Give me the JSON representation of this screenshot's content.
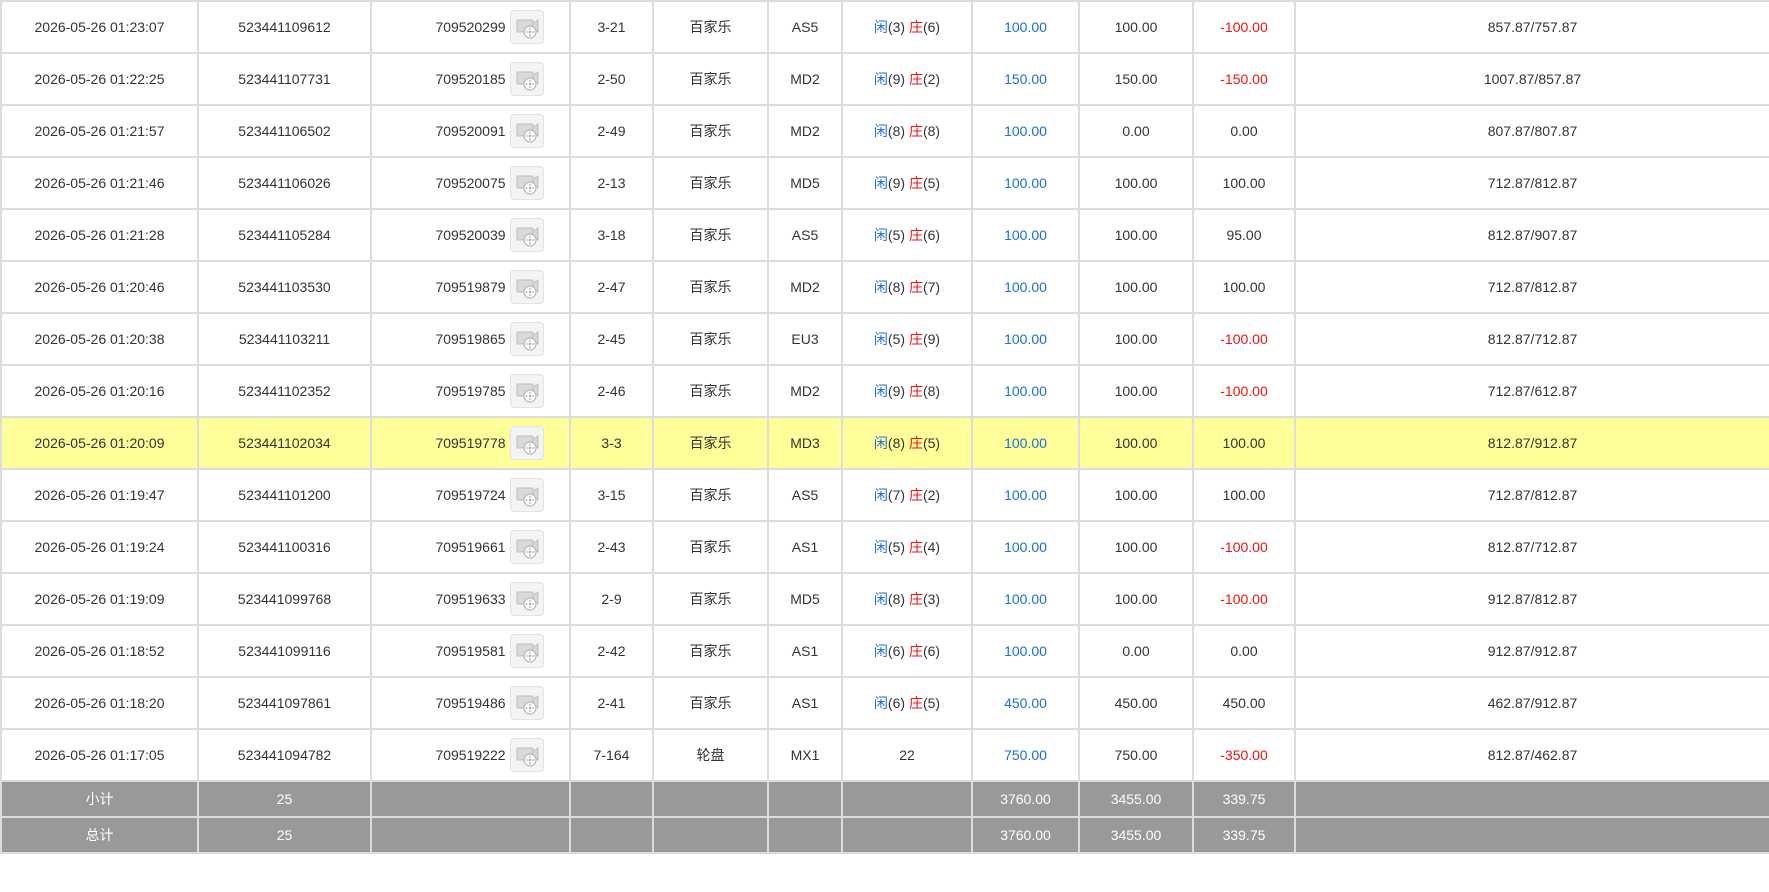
{
  "colors": {
    "positive": "#1a6fe0",
    "negative": "#ee1111",
    "highlight_row": "#ffff99",
    "summary_bg": "#999999"
  },
  "icons": {
    "replay": "film-reel-icon"
  },
  "rows": [
    {
      "time": "2026-05-26 01:23:07",
      "bet_no": "523441109612",
      "game_no": "709520299",
      "shoe": "3-21",
      "game": "百家乐",
      "table": "AS5",
      "player_label": "闲",
      "player_val": "(3)",
      "banker_label": "庄",
      "banker_val": "(6)",
      "result_text": "",
      "bet": "100.00",
      "valid": "100.00",
      "win": "-100.00",
      "win_neg": true,
      "balance": "857.87/757.87",
      "highlight": false
    },
    {
      "time": "2026-05-26 01:22:25",
      "bet_no": "523441107731",
      "game_no": "709520185",
      "shoe": "2-50",
      "game": "百家乐",
      "table": "MD2",
      "player_label": "闲",
      "player_val": "(9)",
      "banker_label": "庄",
      "banker_val": "(2)",
      "result_text": "",
      "bet": "150.00",
      "valid": "150.00",
      "win": "-150.00",
      "win_neg": true,
      "balance": "1007.87/857.87",
      "highlight": false
    },
    {
      "time": "2026-05-26 01:21:57",
      "bet_no": "523441106502",
      "game_no": "709520091",
      "shoe": "2-49",
      "game": "百家乐",
      "table": "MD2",
      "player_label": "闲",
      "player_val": "(8)",
      "banker_label": "庄",
      "banker_val": "(8)",
      "result_text": "",
      "bet": "100.00",
      "valid": "0.00",
      "win": "0.00",
      "win_neg": false,
      "balance": "807.87/807.87",
      "highlight": false
    },
    {
      "time": "2026-05-26 01:21:46",
      "bet_no": "523441106026",
      "game_no": "709520075",
      "shoe": "2-13",
      "game": "百家乐",
      "table": "MD5",
      "player_label": "闲",
      "player_val": "(9)",
      "banker_label": "庄",
      "banker_val": "(5)",
      "result_text": "",
      "bet": "100.00",
      "valid": "100.00",
      "win": "100.00",
      "win_neg": false,
      "balance": "712.87/812.87",
      "highlight": false
    },
    {
      "time": "2026-05-26 01:21:28",
      "bet_no": "523441105284",
      "game_no": "709520039",
      "shoe": "3-18",
      "game": "百家乐",
      "table": "AS5",
      "player_label": "闲",
      "player_val": "(5)",
      "banker_label": "庄",
      "banker_val": "(6)",
      "result_text": "",
      "bet": "100.00",
      "valid": "100.00",
      "win": "95.00",
      "win_neg": false,
      "balance": "812.87/907.87",
      "highlight": false
    },
    {
      "time": "2026-05-26 01:20:46",
      "bet_no": "523441103530",
      "game_no": "709519879",
      "shoe": "2-47",
      "game": "百家乐",
      "table": "MD2",
      "player_label": "闲",
      "player_val": "(8)",
      "banker_label": "庄",
      "banker_val": "(7)",
      "result_text": "",
      "bet": "100.00",
      "valid": "100.00",
      "win": "100.00",
      "win_neg": false,
      "balance": "712.87/812.87",
      "highlight": false
    },
    {
      "time": "2026-05-26 01:20:38",
      "bet_no": "523441103211",
      "game_no": "709519865",
      "shoe": "2-45",
      "game": "百家乐",
      "table": "EU3",
      "player_label": "闲",
      "player_val": "(5)",
      "banker_label": "庄",
      "banker_val": "(9)",
      "result_text": "",
      "bet": "100.00",
      "valid": "100.00",
      "win": "-100.00",
      "win_neg": true,
      "balance": "812.87/712.87",
      "highlight": false
    },
    {
      "time": "2026-05-26 01:20:16",
      "bet_no": "523441102352",
      "game_no": "709519785",
      "shoe": "2-46",
      "game": "百家乐",
      "table": "MD2",
      "player_label": "闲",
      "player_val": "(9)",
      "banker_label": "庄",
      "banker_val": "(8)",
      "result_text": "",
      "bet": "100.00",
      "valid": "100.00",
      "win": "-100.00",
      "win_neg": true,
      "balance": "712.87/612.87",
      "highlight": false
    },
    {
      "time": "2026-05-26 01:20:09",
      "bet_no": "523441102034",
      "game_no": "709519778",
      "shoe": "3-3",
      "game": "百家乐",
      "table": "MD3",
      "player_label": "闲",
      "player_val": "(8)",
      "banker_label": "庄",
      "banker_val": "(5)",
      "result_text": "",
      "bet": "100.00",
      "valid": "100.00",
      "win": "100.00",
      "win_neg": false,
      "balance": "812.87/912.87",
      "highlight": true
    },
    {
      "time": "2026-05-26 01:19:47",
      "bet_no": "523441101200",
      "game_no": "709519724",
      "shoe": "3-15",
      "game": "百家乐",
      "table": "AS5",
      "player_label": "闲",
      "player_val": "(7)",
      "banker_label": "庄",
      "banker_val": "(2)",
      "result_text": "",
      "bet": "100.00",
      "valid": "100.00",
      "win": "100.00",
      "win_neg": false,
      "balance": "712.87/812.87",
      "highlight": false
    },
    {
      "time": "2026-05-26 01:19:24",
      "bet_no": "523441100316",
      "game_no": "709519661",
      "shoe": "2-43",
      "game": "百家乐",
      "table": "AS1",
      "player_label": "闲",
      "player_val": "(5)",
      "banker_label": "庄",
      "banker_val": "(4)",
      "result_text": "",
      "bet": "100.00",
      "valid": "100.00",
      "win": "-100.00",
      "win_neg": true,
      "balance": "812.87/712.87",
      "highlight": false
    },
    {
      "time": "2026-05-26 01:19:09",
      "bet_no": "523441099768",
      "game_no": "709519633",
      "shoe": "2-9",
      "game": "百家乐",
      "table": "MD5",
      "player_label": "闲",
      "player_val": "(8)",
      "banker_label": "庄",
      "banker_val": "(3)",
      "result_text": "",
      "bet": "100.00",
      "valid": "100.00",
      "win": "-100.00",
      "win_neg": true,
      "balance": "912.87/812.87",
      "highlight": false
    },
    {
      "time": "2026-05-26 01:18:52",
      "bet_no": "523441099116",
      "game_no": "709519581",
      "shoe": "2-42",
      "game": "百家乐",
      "table": "AS1",
      "player_label": "闲",
      "player_val": "(6)",
      "banker_label": "庄",
      "banker_val": "(6)",
      "result_text": "",
      "bet": "100.00",
      "valid": "0.00",
      "win": "0.00",
      "win_neg": false,
      "balance": "912.87/912.87",
      "highlight": false
    },
    {
      "time": "2026-05-26 01:18:20",
      "bet_no": "523441097861",
      "game_no": "709519486",
      "shoe": "2-41",
      "game": "百家乐",
      "table": "AS1",
      "player_label": "闲",
      "player_val": "(6)",
      "banker_label": "庄",
      "banker_val": "(5)",
      "result_text": "",
      "bet": "450.00",
      "valid": "450.00",
      "win": "450.00",
      "win_neg": false,
      "balance": "462.87/912.87",
      "highlight": false
    },
    {
      "time": "2026-05-26 01:17:05",
      "bet_no": "523441094782",
      "game_no": "709519222",
      "shoe": "7-164",
      "game": "轮盘",
      "table": "MX1",
      "player_label": "",
      "player_val": "",
      "banker_label": "",
      "banker_val": "",
      "result_text": "22",
      "bet": "750.00",
      "valid": "750.00",
      "win": "-350.00",
      "win_neg": true,
      "balance": "812.87/462.87",
      "highlight": false
    }
  ],
  "subtotal": {
    "label": "小计",
    "count": "25",
    "bet": "3760.00",
    "valid": "3455.00",
    "win": "339.75"
  },
  "total": {
    "label": "总计",
    "count": "25",
    "bet": "3760.00",
    "valid": "3455.00",
    "win": "339.75"
  }
}
